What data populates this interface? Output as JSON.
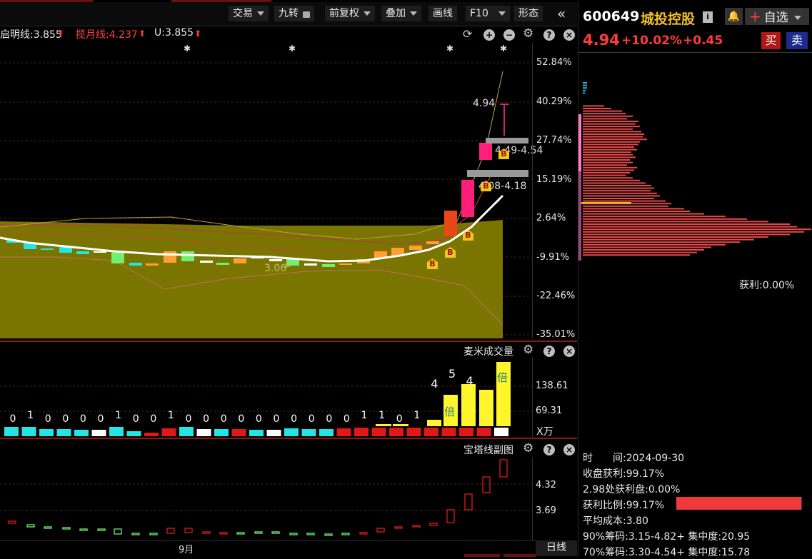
{
  "toolbar": {
    "items": [
      "交易",
      "九转",
      "前复权",
      "叠加",
      "画线",
      "F10",
      "形态"
    ]
  },
  "indicators": {
    "line1": "启明线:3.855",
    "line2": "揽月线:4.237",
    "line3": "U:3.855"
  },
  "main_axis": [
    "52.84%",
    "40.29%",
    "27.74%",
    "15.19%",
    "2.64%",
    "-9.91%",
    "-22.46%",
    "-35.01%"
  ],
  "annotations": {
    "price_high": "4.94",
    "zone1": "4.49-4.54",
    "zone2": "4.08-4.18",
    "low_label": "3.06",
    "buy_mark": "B"
  },
  "volume_panel": {
    "title": "麦米成交量",
    "axis": [
      "138.61",
      "69.31"
    ],
    "unit": "X万",
    "counts": [
      "0",
      "1",
      "0",
      "0",
      "0",
      "0",
      "1",
      "0",
      "0",
      "1",
      "0",
      "0",
      "0",
      "0",
      "0",
      "0",
      "0",
      "0",
      "0",
      "0",
      "1",
      "1",
      "0",
      "1",
      "4",
      "5",
      "4"
    ],
    "badge": "倍"
  },
  "tower_panel": {
    "title": "宝塔线副图",
    "axis": [
      "4.32",
      "3.69"
    ]
  },
  "x_axis": {
    "month_label": "9月",
    "period": "日线"
  },
  "quote": {
    "code": "600649",
    "name": "城投控股",
    "price": "4.94",
    "change_pct": "+10.02%",
    "change": "+0.45",
    "watch_label": "自选",
    "buy": "买",
    "sell": "卖"
  },
  "chip": {
    "profit_top": "获利:0.00%",
    "time": "时　　间:2024-09-30",
    "close_profit": "收盘获利:99.17%",
    "at_price": "2.98处获利盘:0.00%",
    "ratio": "获利比例:99.17%",
    "ratio_value": 0.9917,
    "avg_cost": "平均成本:3.80",
    "c90": "90%筹码:3.15-4.82+ 集中度:20.95",
    "c70": "70%筹码:3.30-4.54+ 集中度:15.78"
  },
  "colors": {
    "up": "#ff3333",
    "down": "#22e5e5",
    "gold": "#f0c61a",
    "band": "#7a7400"
  }
}
